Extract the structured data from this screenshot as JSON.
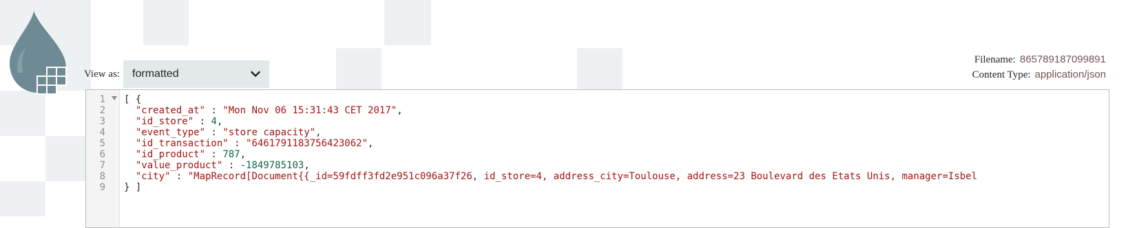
{
  "view_as": {
    "label": "View as:",
    "selected": "formatted"
  },
  "meta": {
    "filename_label": "Filename:",
    "filename_value": "865789187099891",
    "content_type_label": "Content Type:",
    "content_type_value": "application/json"
  },
  "editor": {
    "line_numbers": [
      "1",
      "2",
      "3",
      "4",
      "5",
      "6",
      "7",
      "8",
      "9"
    ],
    "open": "[ {",
    "close": "} ]",
    "fields": [
      {
        "key": "\"created_at\"",
        "sep": " : ",
        "value": "\"Mon Nov 06 15:31:43 CET 2017\"",
        "tail": ",",
        "kind": "string"
      },
      {
        "key": "\"id_store\"",
        "sep": " : ",
        "value": "4",
        "tail": ",",
        "kind": "number"
      },
      {
        "key": "\"event_type\"",
        "sep": " : ",
        "value": "\"store capacity\"",
        "tail": ",",
        "kind": "string"
      },
      {
        "key": "\"id_transaction\"",
        "sep": " : ",
        "value": "\"6461791183756423062\"",
        "tail": ",",
        "kind": "string"
      },
      {
        "key": "\"id_product\"",
        "sep": " : ",
        "value": "787",
        "tail": ",",
        "kind": "number"
      },
      {
        "key": "\"value_product\"",
        "sep": " : ",
        "value": "-1849785103",
        "tail": ",",
        "kind": "number"
      },
      {
        "key": "\"city\"",
        "sep": " : ",
        "value": "\"MapRecord[Document{{_id=59fdff3fd2e951c096a37f26, id_store=4, address_city=Toulouse, address=23 Boulevard des Etats Unis, manager=Isbel",
        "tail": "",
        "kind": "string"
      }
    ]
  }
}
